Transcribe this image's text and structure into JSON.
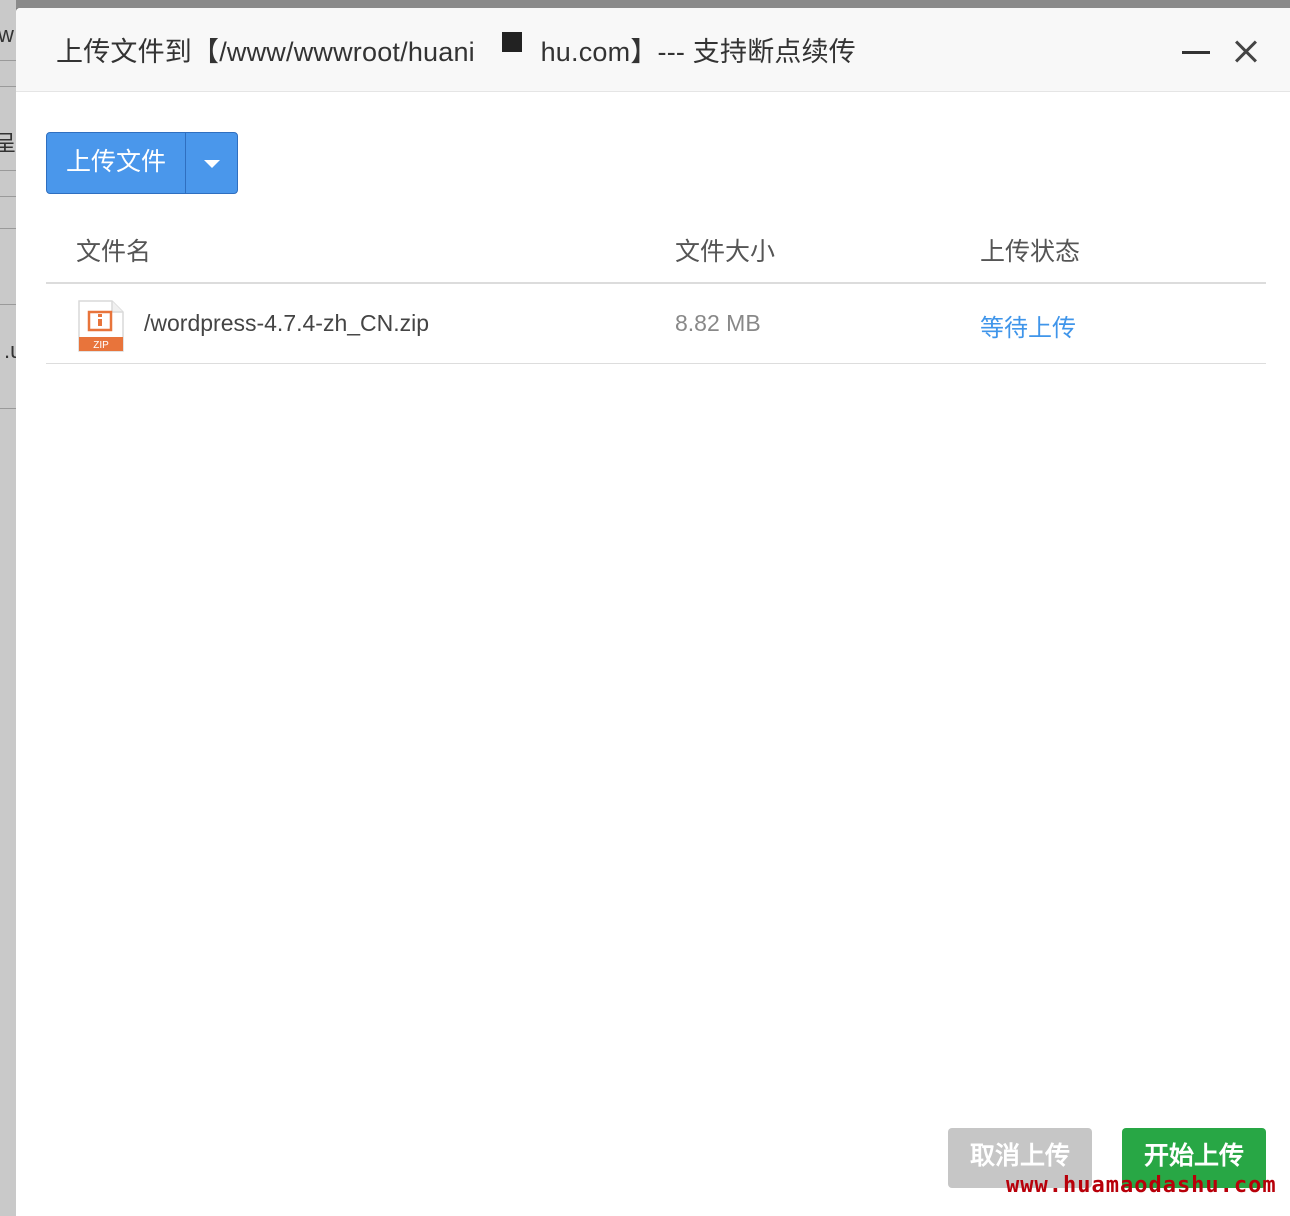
{
  "background": {
    "fragments": [
      "w",
      "呈",
      ".u"
    ]
  },
  "dialog": {
    "title": "上传文件到【/www/wwwroot/huani",
    "title_tail": "shu.com】--- 支持断点续传",
    "minimize_icon": "minimize-icon",
    "close_icon": "close-icon"
  },
  "toolbar": {
    "upload_label": "上传文件",
    "dropdown_icon": "caret-down-icon"
  },
  "table": {
    "headers": {
      "name": "文件名",
      "size": "文件大小",
      "status": "上传状态"
    },
    "rows": [
      {
        "icon": "zip-file-icon",
        "icon_label": "ZIP",
        "name": "/wordpress-4.7.4-zh_CN.zip",
        "size": "8.82 MB",
        "status": "等待上传"
      }
    ]
  },
  "footer": {
    "cancel_label": "取消上传",
    "start_label": "开始上传"
  },
  "watermark": "www.huamaodashu.com",
  "colors": {
    "primary": "#4a97eb",
    "success": "#28a745",
    "disabled": "#c6c6c6",
    "status_link": "#3f95ea"
  }
}
